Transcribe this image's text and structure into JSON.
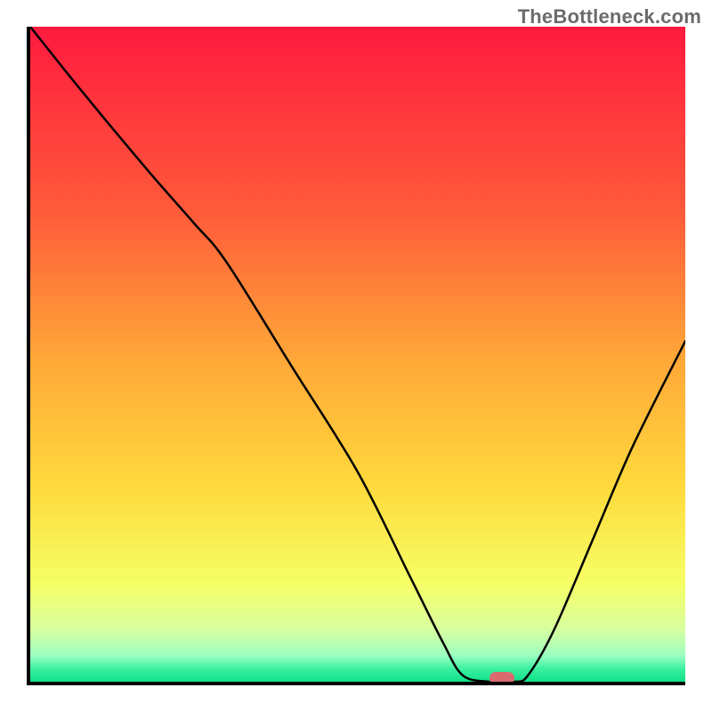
{
  "watermark": "TheBottleneck.com",
  "chart_data": {
    "type": "line",
    "title": "",
    "xlabel": "",
    "ylabel": "",
    "xlim": [
      0,
      100
    ],
    "ylim": [
      0,
      100
    ],
    "grid": false,
    "legend": null,
    "background_gradient": {
      "stops": [
        {
          "pos": 0.0,
          "color": "#ff1a3f"
        },
        {
          "pos": 0.28,
          "color": "#ff5a3a"
        },
        {
          "pos": 0.5,
          "color": "#ffa538"
        },
        {
          "pos": 0.7,
          "color": "#ffd93c"
        },
        {
          "pos": 0.85,
          "color": "#f6ff66"
        },
        {
          "pos": 0.92,
          "color": "#d8ffa0"
        },
        {
          "pos": 0.96,
          "color": "#9dffc0"
        },
        {
          "pos": 0.98,
          "color": "#3cf0a2"
        },
        {
          "pos": 1.0,
          "color": "#0fe089"
        }
      ]
    },
    "series": [
      {
        "name": "bottleneck-curve",
        "data": [
          {
            "x": 0,
            "y": 100
          },
          {
            "x": 8,
            "y": 90
          },
          {
            "x": 18,
            "y": 78
          },
          {
            "x": 25,
            "y": 70
          },
          {
            "x": 30,
            "y": 64
          },
          {
            "x": 40,
            "y": 48
          },
          {
            "x": 50,
            "y": 32
          },
          {
            "x": 58,
            "y": 16
          },
          {
            "x": 63,
            "y": 6
          },
          {
            "x": 66,
            "y": 1
          },
          {
            "x": 70,
            "y": 0
          },
          {
            "x": 74,
            "y": 0
          },
          {
            "x": 76,
            "y": 1
          },
          {
            "x": 80,
            "y": 8
          },
          {
            "x": 86,
            "y": 22
          },
          {
            "x": 92,
            "y": 36
          },
          {
            "x": 100,
            "y": 52
          }
        ]
      }
    ],
    "marker": {
      "x": 72,
      "y": 0,
      "shape": "pill",
      "color": "#d96a6e"
    }
  }
}
